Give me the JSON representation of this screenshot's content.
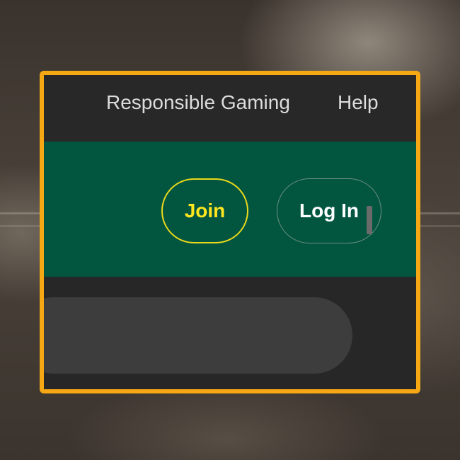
{
  "topbar": {
    "links": [
      {
        "label": "Responsible Gaming"
      },
      {
        "label": "Help"
      }
    ]
  },
  "auth": {
    "join_label": "Join",
    "login_label": "Log In"
  },
  "search": {
    "value": "",
    "placeholder": ""
  },
  "colors": {
    "highlight_border": "#f5a714",
    "topbar_bg": "#282828",
    "brand_green": "#025640",
    "join_accent": "#ffe61e",
    "search_bg": "#3d3d3d"
  }
}
